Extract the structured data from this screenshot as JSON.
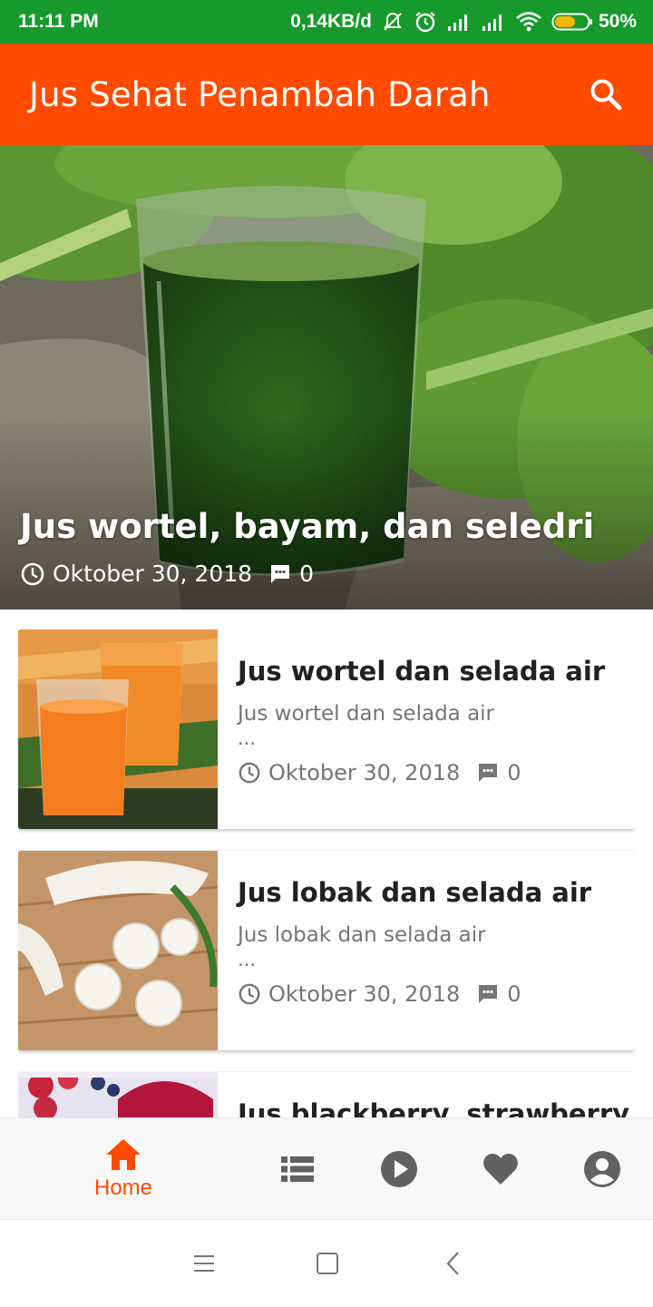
{
  "status_bar": {
    "time": "11:11 PM",
    "network_speed": "0,14KB/d",
    "battery": "50%",
    "icons": [
      "mute-alarm-icon",
      "alarm-icon",
      "signal-icon",
      "signal-icon",
      "wifi-icon",
      "battery-icon"
    ]
  },
  "app_bar": {
    "title": "Jus Sehat Penambah Darah",
    "search_icon": "search-icon"
  },
  "hero": {
    "title": "Jus wortel, bayam, dan seledri",
    "date": "Oktober 30, 2018",
    "comments": "0"
  },
  "posts": [
    {
      "title": "Jus wortel dan selada air",
      "excerpt": "Jus wortel dan selada air",
      "ellipsis": "...",
      "date": "Oktober 30, 2018",
      "comments": "0"
    },
    {
      "title": "Jus lobak dan selada air",
      "excerpt": "Jus lobak dan selada air",
      "ellipsis": "...",
      "date": "Oktober 30, 2018",
      "comments": "0"
    },
    {
      "title": "Jus blackberry, strawberry,"
    }
  ],
  "bottom_nav": {
    "home_label": "Home",
    "items": [
      "home-icon",
      "list-icon",
      "play-icon",
      "heart-icon",
      "account-icon"
    ],
    "active_color": "#ff4a00",
    "inactive_color": "#616161"
  },
  "colors": {
    "status_bar": "#159a2b",
    "app_bar": "#ff4a00"
  }
}
